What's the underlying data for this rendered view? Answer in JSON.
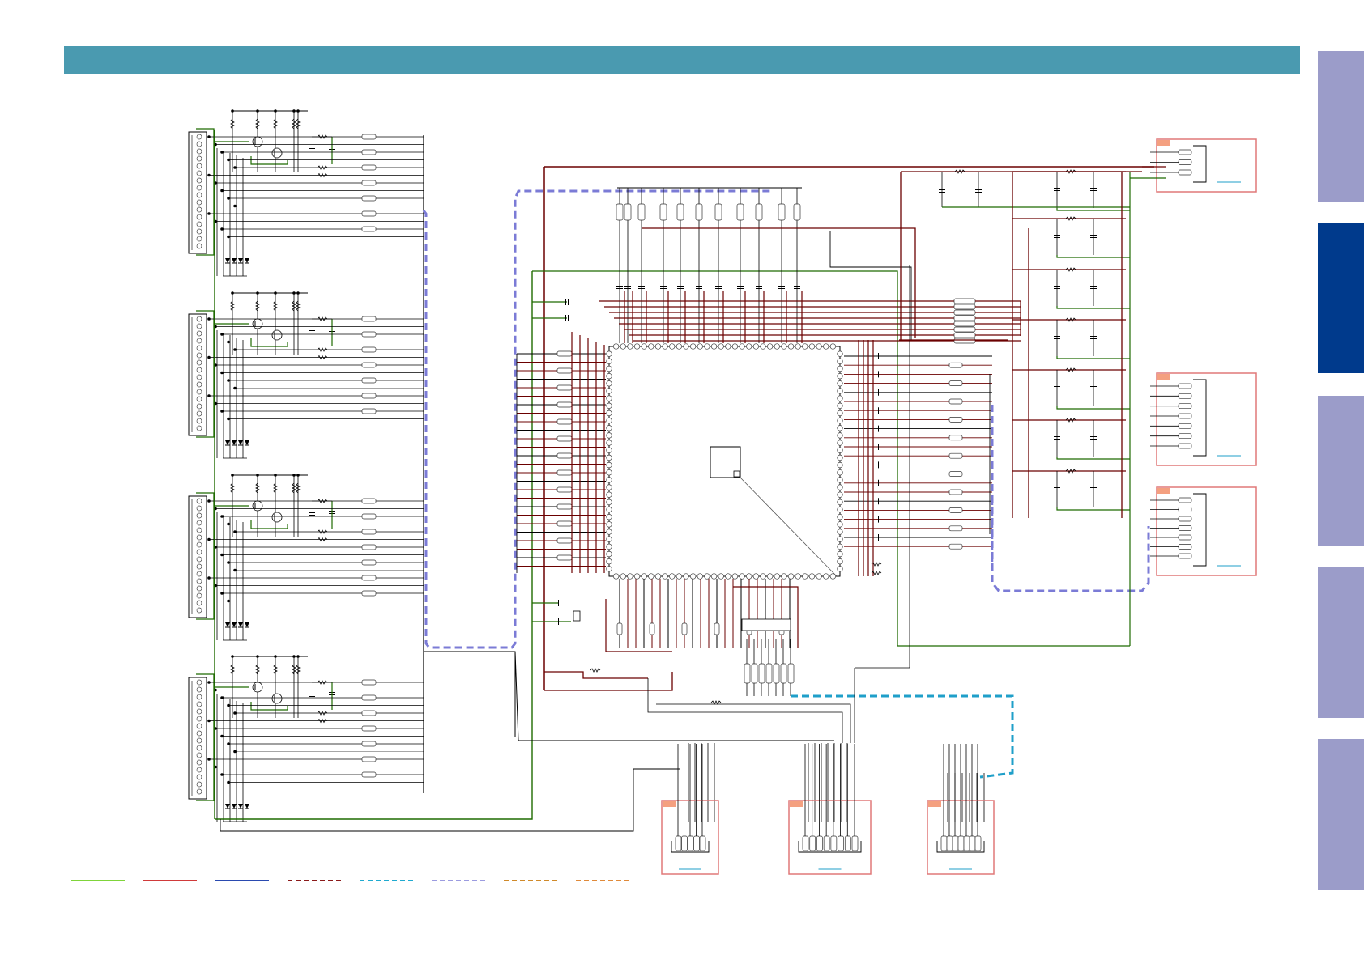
{
  "colors": {
    "header": "#4a9ab0",
    "tab_inactive": "#9b9cc9",
    "tab_active": "#003a8c",
    "wire_black": "#000000",
    "wire_green": "#1f6b00",
    "wire_darkred": "#6b0000",
    "dash_blue": "#7b7bd6",
    "dash_cyan": "#1f9fc9",
    "connector_border": "#e07878",
    "connector_tag": "#f4a080",
    "link_blue": "#1f9fc9"
  },
  "side_tabs": [
    {
      "state": "inactive"
    },
    {
      "state": "active"
    },
    {
      "state": "inactive"
    },
    {
      "state": "inactive"
    },
    {
      "state": "inactive"
    }
  ],
  "legend": [
    {
      "color": "#7fd43a",
      "style": "solid"
    },
    {
      "color": "#d03a3a",
      "style": "solid"
    },
    {
      "color": "#2a4ab0",
      "style": "solid"
    },
    {
      "color": "#8b1a1a",
      "style": "dashed"
    },
    {
      "color": "#1faad0",
      "style": "dashed"
    },
    {
      "color": "#9b9be0",
      "style": "dashed"
    },
    {
      "color": "#d08a2a",
      "style": "dashed"
    },
    {
      "color": "#e08a3a",
      "style": "dashed"
    }
  ],
  "icons": {
    "ic": "ic-chip-icon",
    "diode": "diode-icon",
    "transistor": "transistor-icon",
    "resistor": "resistor-icon",
    "capacitor": "capacitor-icon"
  }
}
